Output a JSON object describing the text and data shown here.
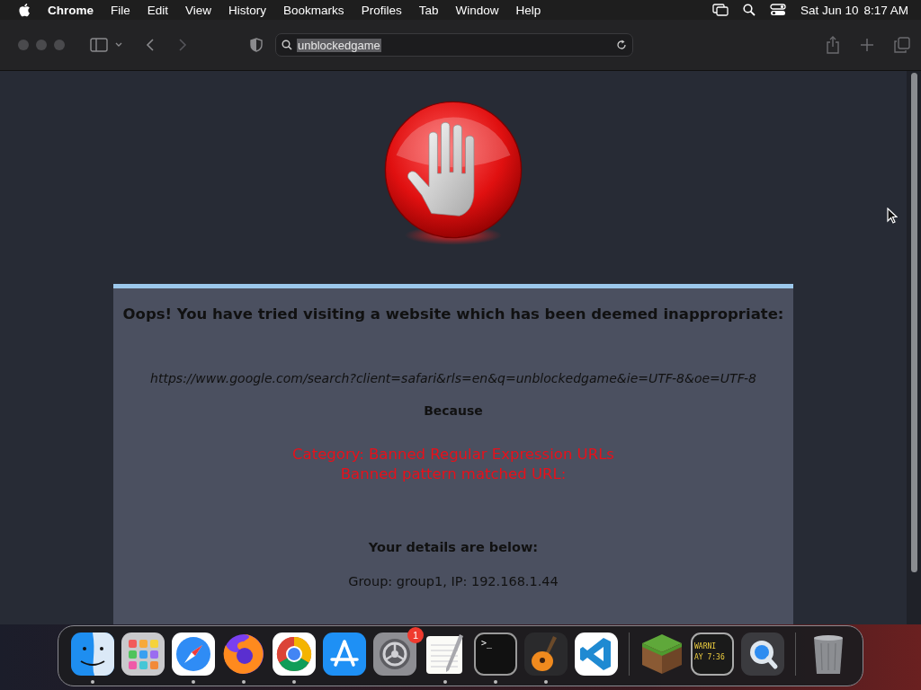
{
  "menu_bar": {
    "app_name": "Chrome",
    "menus": [
      "File",
      "Edit",
      "View",
      "History",
      "Bookmarks",
      "Profiles",
      "Tab",
      "Window",
      "Help"
    ],
    "date": "Sat Jun 10",
    "time": "8:17 AM"
  },
  "toolbar": {
    "address": {
      "value": "unblockedgame",
      "selected": true
    }
  },
  "page": {
    "heading": "Oops! You have tried visiting a website which has been deemed inappropriate:",
    "url": "https://www.google.com/search?client=safari&rls=en&q=unblockedgame&ie=UTF-8&oe=UTF-8",
    "because": "Because",
    "reasons": [
      "Category: Banned Regular Expression URLs",
      "Banned pattern matched URL:"
    ],
    "details_heading": "Your details are below:",
    "details": "Group: group1, IP: 192.168.1.44"
  },
  "dock": {
    "items": [
      {
        "kind": "finder",
        "running": true
      },
      {
        "kind": "launchpad",
        "running": false
      },
      {
        "kind": "safari",
        "running": true
      },
      {
        "kind": "firefox",
        "running": true
      },
      {
        "kind": "chrome",
        "running": true
      },
      {
        "kind": "appstore",
        "running": false
      },
      {
        "kind": "settings",
        "running": false,
        "badge": "1"
      },
      {
        "kind": "textedit",
        "running": true
      },
      {
        "kind": "terminal",
        "running": true,
        "screen_text": ">_"
      },
      {
        "kind": "garageband",
        "running": true
      },
      {
        "kind": "vscode",
        "running": false
      },
      {
        "kind": "separator"
      },
      {
        "kind": "minecraft",
        "running": false
      },
      {
        "kind": "console",
        "running": false,
        "screen_lines": [
          "WARNI",
          "AY 7:36"
        ]
      },
      {
        "kind": "quicktime",
        "running": false
      },
      {
        "kind": "separator"
      },
      {
        "kind": "trash",
        "running": false
      }
    ]
  }
}
